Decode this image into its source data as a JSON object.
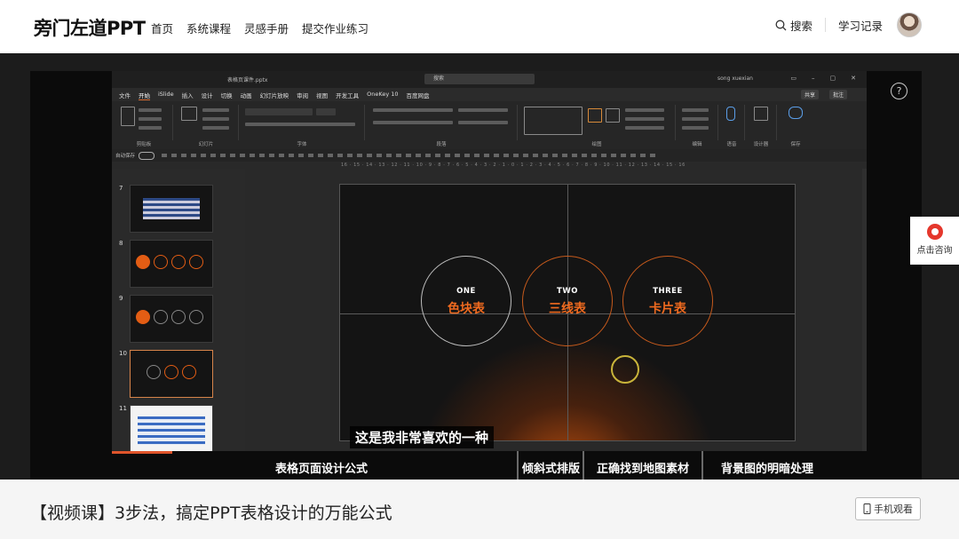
{
  "site": {
    "logo": "旁门左道PPT",
    "nav": [
      "首页",
      "系统课程",
      "灵感手册",
      "提交作业练习"
    ],
    "search_label": "搜索",
    "history_label": "学习记录"
  },
  "ppt": {
    "file_name": "表格页课件.pptx",
    "search_placeholder": "搜索",
    "user": "song xuexian",
    "tabs": [
      "文件",
      "开始",
      "iSlide",
      "插入",
      "设计",
      "切换",
      "动画",
      "幻灯片放映",
      "审阅",
      "视图",
      "开发工具",
      "OneKey 10",
      "百度网盘"
    ],
    "active_tab": "开始",
    "share": "共享",
    "comments": "批注",
    "ribbon_groups": [
      "剪贴板",
      "幻灯片",
      "字体",
      "段落",
      "绘图",
      "编辑",
      "语音",
      "设计器",
      "保存"
    ],
    "qat_label": "自动保存",
    "ruler": "16 · 15 · 14 · 13 · 12 · 11 · 10 · 9 · 8 · 7 · 6 · 5 · 4 · 3 · 2 · 1 · 0 · 1 · 2 · 3 · 4 · 5 · 6 · 7 · 8 · 9 · 10 · 11 · 12 · 13 · 14 · 15 · 16",
    "thumb_numbers": [
      "7",
      "8",
      "9",
      "10",
      "11"
    ],
    "circles": [
      {
        "en": "ONE",
        "cn": "色块表"
      },
      {
        "en": "TWO",
        "cn": "三线表"
      },
      {
        "en": "THREE",
        "cn": "卡片表"
      }
    ],
    "subtitle": "这是我非常喜欢的一种"
  },
  "chapters": [
    "表格页面设计公式",
    "倾斜式排版",
    "正确找到地图素材",
    "背景图的明暗处理"
  ],
  "video_title": "【视频课】3步法，搞定PPT表格设计的万能公式",
  "mobile_watch": "手机观看",
  "consult": "点击咨询",
  "colors": {
    "accent": "#e35d14",
    "progress": "#e0552b"
  }
}
